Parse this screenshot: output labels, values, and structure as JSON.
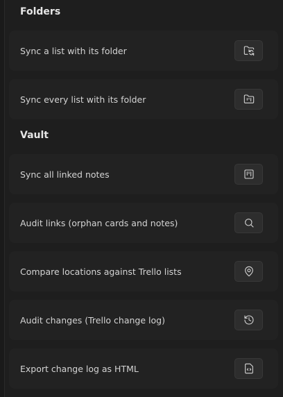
{
  "sections": [
    {
      "heading": "Folders",
      "rows": [
        {
          "label": "Sync a list with its folder",
          "icon": "folder-sync-icon"
        },
        {
          "label": "Sync every list with its folder",
          "icon": "folder-kanban-icon"
        }
      ]
    },
    {
      "heading": "Vault",
      "rows": [
        {
          "label": "Sync all linked notes",
          "icon": "kanban-square-icon"
        },
        {
          "label": "Audit links (orphan cards and notes)",
          "icon": "search-icon"
        },
        {
          "label": "Compare locations against Trello lists",
          "icon": "map-pin-icon"
        },
        {
          "label": "Audit changes (Trello change log)",
          "icon": "history-icon"
        },
        {
          "label": "Export change log as HTML",
          "icon": "file-code-icon"
        }
      ]
    }
  ]
}
